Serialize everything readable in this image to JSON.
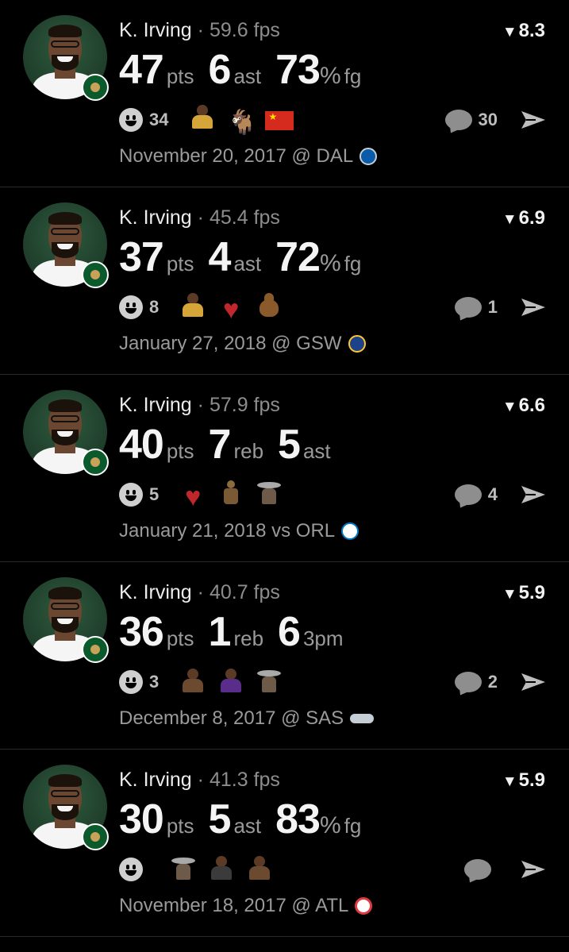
{
  "feed": {
    "cards": [
      {
        "player": "K. Irving",
        "separator": "·",
        "fps": "59.6 fps",
        "rating": "8.3",
        "stats": [
          {
            "value": "47",
            "unit": "pts"
          },
          {
            "value": "6",
            "unit": "ast"
          },
          {
            "value": "73",
            "unit": "fg",
            "percent": "%"
          }
        ],
        "reaction_count": "34",
        "reaction_emojis": [
          "lakers-player-emoji",
          "goat-emoji",
          "china-flag-emoji"
        ],
        "comment_count": "30",
        "date": "November 20, 2017 @ DAL",
        "team_logo": "dal"
      },
      {
        "player": "K. Irving",
        "separator": "·",
        "fps": "45.4 fps",
        "rating": "6.9",
        "stats": [
          {
            "value": "37",
            "unit": "pts"
          },
          {
            "value": "4",
            "unit": "ast"
          },
          {
            "value": "72",
            "unit": "fg",
            "percent": "%"
          }
        ],
        "reaction_count": "8",
        "reaction_emojis": [
          "lakers-player-emoji",
          "heart-emoji",
          "poop-emoji"
        ],
        "comment_count": "1",
        "date": "January 27, 2018 @ GSW",
        "team_logo": "gsw"
      },
      {
        "player": "K. Irving",
        "separator": "·",
        "fps": "57.9 fps",
        "rating": "6.6",
        "stats": [
          {
            "value": "40",
            "unit": "pts"
          },
          {
            "value": "7",
            "unit": "reb"
          },
          {
            "value": "5",
            "unit": "ast"
          }
        ],
        "reaction_count": "5",
        "reaction_emojis": [
          "heart-emoji",
          "fighter-emoji",
          "cowboy-emoji"
        ],
        "comment_count": "4",
        "date": "January 21, 2018 vs ORL",
        "team_logo": "orl"
      },
      {
        "player": "K. Irving",
        "separator": "·",
        "fps": "40.7 fps",
        "rating": "5.9",
        "stats": [
          {
            "value": "36",
            "unit": "pts"
          },
          {
            "value": "1",
            "unit": "reb"
          },
          {
            "value": "6",
            "unit": "3pm"
          }
        ],
        "reaction_count": "3",
        "reaction_emojis": [
          "player-emoji",
          "purple-player-emoji",
          "cowboy-emoji"
        ],
        "comment_count": "2",
        "date": "December 8, 2017 @ SAS",
        "team_logo": "sas"
      },
      {
        "player": "K. Irving",
        "separator": "·",
        "fps": "41.3 fps",
        "rating": "5.9",
        "stats": [
          {
            "value": "30",
            "unit": "pts"
          },
          {
            "value": "5",
            "unit": "ast"
          },
          {
            "value": "83",
            "unit": "fg",
            "percent": "%"
          }
        ],
        "reaction_count": "",
        "reaction_emojis": [
          "cowboy-emoji",
          "dark-player-emoji",
          "player-emoji"
        ],
        "comment_count": "",
        "date": "November 18, 2017 @ ATL",
        "team_logo": "atl"
      }
    ]
  },
  "colors": {
    "background": "#000000",
    "primary_text": "#f4f4f4",
    "secondary_text": "#9a9a9a",
    "divider": "#2a2a2a"
  }
}
